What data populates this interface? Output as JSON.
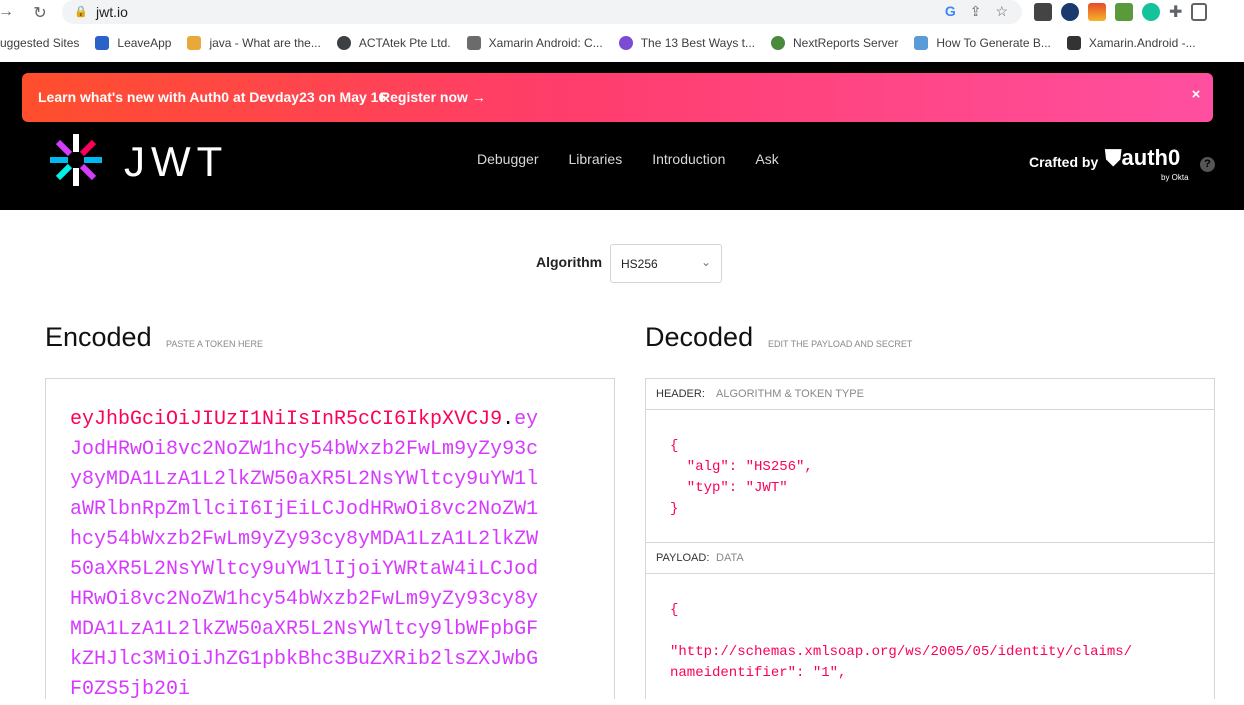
{
  "browser": {
    "url": "jwt.io",
    "bookmarks": [
      {
        "label": "uggested Sites",
        "color": "#ffffff"
      },
      {
        "label": "LeaveApp",
        "color": "#2a62c9"
      },
      {
        "label": "java - What are the...",
        "color": "#e8a93a"
      },
      {
        "label": "ACTAtek Pte Ltd.",
        "color": "#3c4043"
      },
      {
        "label": "Xamarin Android: C...",
        "color": "#6b6b6b"
      },
      {
        "label": "The 13 Best Ways t...",
        "color": "#7b4bd6"
      },
      {
        "label": "NextReports Server",
        "color": "#4a8a3c"
      },
      {
        "label": "How To Generate B...",
        "color": "#5a9bd8"
      },
      {
        "label": "Xamarin.Android -...",
        "color": "#333333"
      }
    ]
  },
  "banner": {
    "message": "Learn what's new with Auth0 at Devday23 on May 16",
    "register": "Register now →",
    "close": "×"
  },
  "header": {
    "logo_text": "JWT",
    "nav": [
      "Debugger",
      "Libraries",
      "Introduction",
      "Ask"
    ],
    "crafted_by": "Crafted by",
    "auth0": "auth0",
    "by_okta": "by Okta",
    "help": "?"
  },
  "algorithm": {
    "label": "Algorithm",
    "selected": "HS256"
  },
  "encoded": {
    "title": "Encoded",
    "subtitle": "PASTE A TOKEN HERE",
    "header_part": "eyJhbGciOiJIUzI1NiIsInR5cCI6IkpXVCJ9",
    "dot": ".",
    "payload_part": "eyJodHRwOi8vc2NoZW1hcy54bWxzb2FwLm9yZy93cy8yMDA1LzA1L2lkZW50aXR5L2NsYWltcy9uYW1laWRlbnRpZmllciI6IjEiLCJodHRwOi8vc2NoZW1hcy54bWxzb2FwLm9yZy93cy8yMDA1LzA1L2lkZW50aXR5L2NsYWltcy9uYW1lIjoiYWRtaW4iLCJodHRwOi8vc2NoZW1hcy54bWxzb2FwLm9yZy93cy8yMDA1LzA1L2lkZW50aXR5L2NsYWltcy9lbWFpbGFkZHJlc3MiOiJhZG1pbkBhc3BuZXRib2lsZXJwbGF0ZS5jb20i"
  },
  "decoded": {
    "title": "Decoded",
    "subtitle": "EDIT THE PAYLOAD AND SECRET",
    "header_label": "HEADER:",
    "header_desc": "ALGORITHM & TOKEN TYPE",
    "header_json": "{\n  \"alg\": \"HS256\",\n  \"typ\": \"JWT\"\n}",
    "payload_label": "PAYLOAD:",
    "payload_desc": "DATA",
    "payload_json": "{\n\n\"http://schemas.xmlsoap.org/ws/2005/05/identity/claims/\nnameidentifier\": \"1\","
  }
}
